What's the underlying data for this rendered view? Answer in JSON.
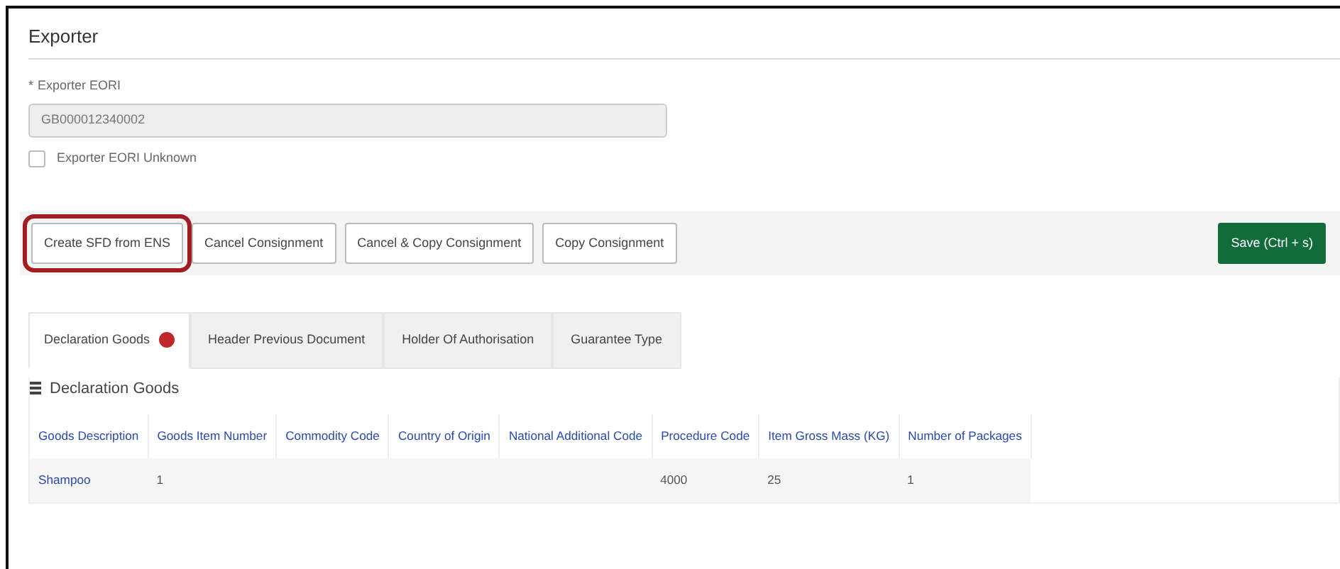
{
  "section": {
    "title": "Exporter"
  },
  "eori_field": {
    "label": "Exporter EORI",
    "required_mark": "*",
    "value": "GB000012340002",
    "disabled": true
  },
  "unknown_checkbox": {
    "label": "Exporter EORI Unknown",
    "checked": false
  },
  "actions": [
    {
      "label": "Create SFD from ENS",
      "kind": "outline",
      "highlighted": true
    },
    {
      "label": "Cancel Consignment",
      "kind": "outline",
      "highlighted": false
    },
    {
      "label": "Cancel & Copy Consignment",
      "kind": "outline",
      "highlighted": false
    },
    {
      "label": "Copy Consignment",
      "kind": "outline",
      "highlighted": false
    },
    {
      "label": "Save (Ctrl + s)",
      "kind": "primary",
      "highlighted": false
    }
  ],
  "tabs": [
    {
      "label": "Declaration Goods",
      "selected": true,
      "error": true
    },
    {
      "label": "Header Previous Document",
      "selected": false,
      "error": false
    },
    {
      "label": "Holder Of Authorisation",
      "selected": false,
      "error": false
    },
    {
      "label": "Guarantee Type",
      "selected": false,
      "error": false
    }
  ],
  "panel": {
    "title": "Declaration Goods"
  },
  "table": {
    "columns": [
      "Goods Description",
      "Goods Item Number",
      "Commodity Code",
      "Country of Origin",
      "National Additional Code",
      "Procedure Code",
      "Item Gross Mass (KG)",
      "Number of Packages"
    ],
    "rows": [
      [
        "Shampoo",
        "1",
        "",
        "",
        "",
        "4000",
        "25",
        "1"
      ]
    ]
  }
}
